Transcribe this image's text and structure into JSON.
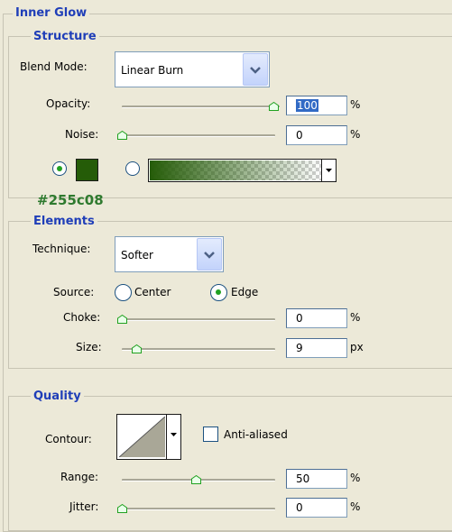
{
  "panel": {
    "title": "Inner Glow",
    "structure": {
      "title": "Structure",
      "blend_mode": {
        "label": "Blend Mode:",
        "value": "Linear Burn"
      },
      "opacity": {
        "label": "Opacity:",
        "value": "100",
        "unit": "%",
        "slider_fraction": 1.0
      },
      "noise": {
        "label": "Noise:",
        "value": "0",
        "unit": "%",
        "slider_fraction": 0.0
      },
      "color_swatch": "#255c08",
      "color_caption": "#255c08"
    },
    "elements": {
      "title": "Elements",
      "technique": {
        "label": "Technique:",
        "value": "Softer"
      },
      "source": {
        "label": "Source:",
        "center": "Center",
        "edge": "Edge",
        "selected": "edge"
      },
      "choke": {
        "label": "Choke:",
        "value": "0",
        "unit": "%",
        "slider_fraction": 0.0
      },
      "size": {
        "label": "Size:",
        "value": "9",
        "unit": "px",
        "slider_fraction": 0.05
      }
    },
    "quality": {
      "title": "Quality",
      "contour": {
        "label": "Contour:"
      },
      "anti_aliased": {
        "label": "Anti-aliased",
        "checked": false
      },
      "range": {
        "label": "Range:",
        "value": "50",
        "unit": "%",
        "slider_fraction": 0.5
      },
      "jitter": {
        "label": "Jitter:",
        "value": "0",
        "unit": "%",
        "slider_fraction": 0.0
      }
    }
  },
  "colors": {
    "heading": "#1f3eb8",
    "caption": "#2f7a2f",
    "radio_dot": "#21a121",
    "dropdown_arrow": "#4d6185"
  },
  "icons": {
    "dropdown": "chevron-down-icon",
    "slider_thumb": "slider-thumb-icon",
    "small_dropdown": "caret-down-icon"
  }
}
